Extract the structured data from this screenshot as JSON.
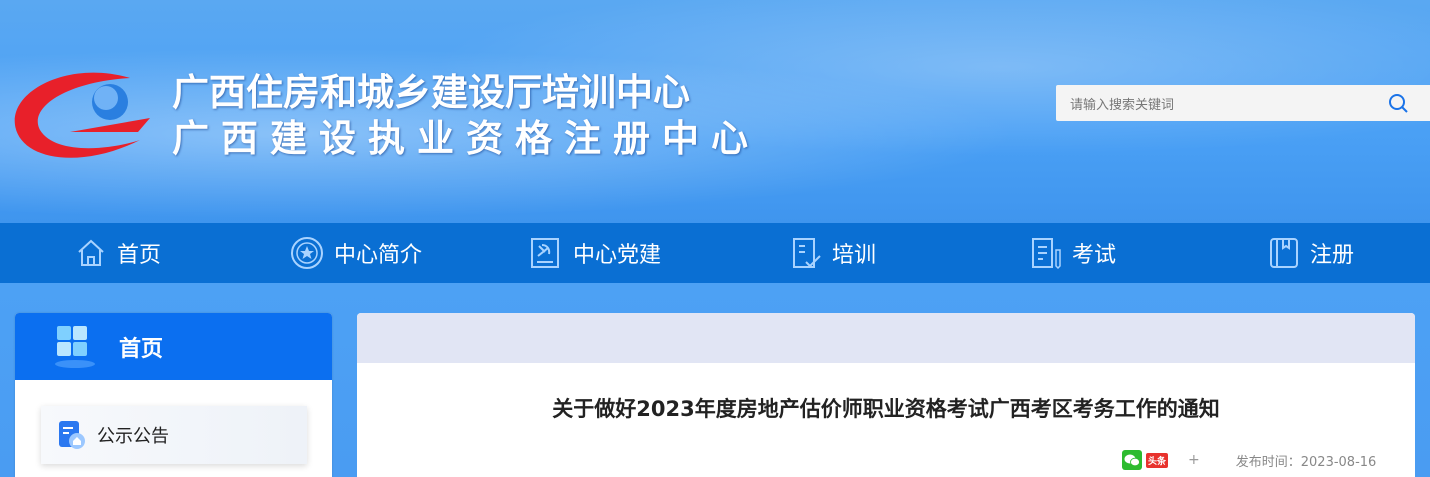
{
  "header": {
    "title_line1": "广西住房和城乡建设厅培训中心",
    "title_line2": "广西建设执业资格注册中心",
    "search_placeholder": "请输入搜索关键词",
    "search_icon": "search-icon"
  },
  "nav": {
    "items": [
      {
        "label": "首页",
        "icon": "home-icon"
      },
      {
        "label": "中心简介",
        "icon": "star-circle-icon"
      },
      {
        "label": "中心党建",
        "icon": "party-emblem-icon"
      },
      {
        "label": "培训",
        "icon": "clipboard-check-icon"
      },
      {
        "label": "考试",
        "icon": "exam-paper-icon"
      },
      {
        "label": "注册",
        "icon": "notebook-icon"
      }
    ]
  },
  "sidebar": {
    "heading": "首页",
    "items": [
      {
        "label": "公示公告",
        "icon": "announcement-icon"
      }
    ]
  },
  "article": {
    "title": "关于做好2023年度房地产估价师职业资格考试广西考区考务工作的通知",
    "share_toutiao": "头条",
    "share_plus": "+",
    "publish_time": "发布时间：2023-08-16"
  },
  "colors": {
    "nav_bg": "#0a6fd3",
    "sidebar_head_bg": "#0b6ff0",
    "content_bar_bg": "#e1e5f4"
  }
}
